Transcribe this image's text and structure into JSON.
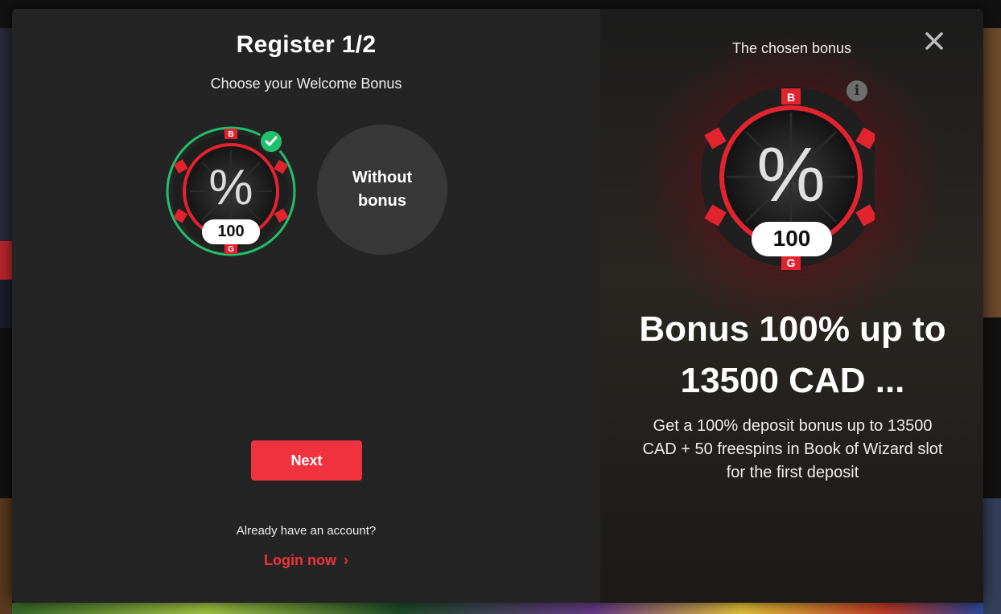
{
  "register": {
    "title": "Register 1/2",
    "subtitle": "Choose your Welcome Bonus",
    "selected_chip_value": "100",
    "without_bonus_label": "Without bonus",
    "next_label": "Next",
    "already_text": "Already have an account?",
    "login_label": "Login now",
    "login_chevron": "›"
  },
  "panel": {
    "chosen_label": "The chosen bonus",
    "close_glyph": "×",
    "info_glyph": "i",
    "chip_value": "100",
    "chip_symbol": "%",
    "headline": "Bonus 100% up to 13500 CAD ...",
    "description": "Get a 100% deposit bonus up to 13500 CAD + 50 freespins in Book of Wizard slot for the first deposit"
  },
  "chip_letters": [
    "B",
    "G"
  ],
  "colors": {
    "accent_red": "#f0323e",
    "selected_green": "#21c06c",
    "modal_dark": "#242424"
  },
  "icons": [
    "percent-chip-icon",
    "check-icon",
    "close-icon",
    "info-icon",
    "chevron-right-icon"
  ]
}
